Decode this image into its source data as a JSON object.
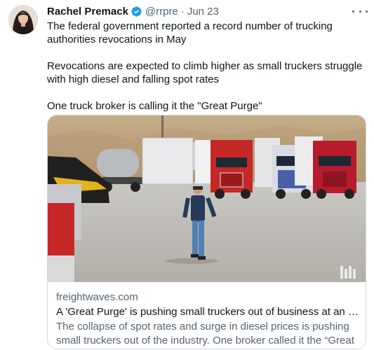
{
  "author": {
    "name": "Rachel Premack",
    "handle": "@rrpre",
    "separator": "·",
    "date": "Jun 23",
    "verified": true
  },
  "tweet": {
    "paragraphs": [
      "The federal government reported a record number of trucking authorities revocations in May",
      "Revocations are expected to climb higher as small truckers struggle with high diesel and falling spot rates",
      "One truck broker is calling it the \"Great Purge\""
    ]
  },
  "card": {
    "domain": "freightwaves.com",
    "title": "A 'Great Purge' is pushing small truckers out of business at an unprec...",
    "description": "The collapse of spot rates and surge in diesel prices is pushing small truckers out of the industry. One broker called it the “Great Purge.”"
  },
  "icons": {
    "verified": "verified-badge-icon",
    "more": "more-options-icon",
    "watermark": "freightwaves-logo"
  },
  "colors": {
    "verified_blue": "#1d9bf0",
    "secondary_text": "#536471",
    "border": "#cfd9de"
  }
}
